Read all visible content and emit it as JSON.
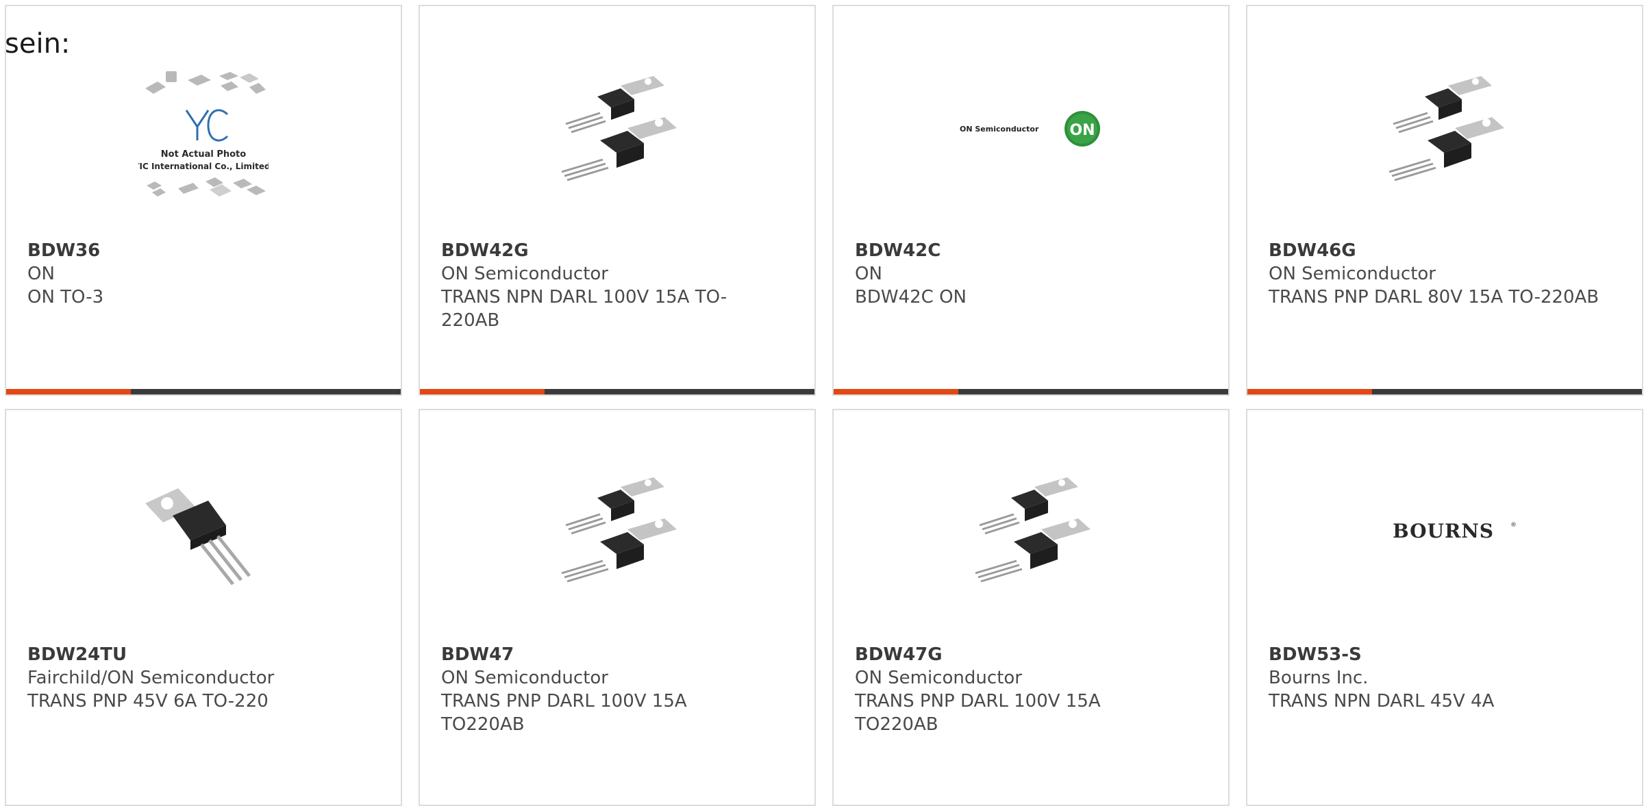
{
  "lead_text": "sein:",
  "colors": {
    "accent": "#e24715",
    "bar": "#3b3b3b",
    "border": "#dcdcdc",
    "text": "#4a4a4a"
  },
  "products": [
    {
      "part": "BDW36",
      "manufacturer": "ON",
      "description": "ON TO-3",
      "image": "yic-placeholder-image",
      "placeholder_line1": "Not Actual Photo",
      "placeholder_line2": "YIC International Co., Limited."
    },
    {
      "part": "BDW42G",
      "manufacturer": "ON Semiconductor",
      "description": "TRANS NPN DARL 100V 15A TO-220AB",
      "image": "to220-pair-image"
    },
    {
      "part": "BDW42C",
      "manufacturer": "ON",
      "description": "BDW42C ON",
      "image": "on-semiconductor-logo",
      "logo_text": "ON Semiconductor"
    },
    {
      "part": "BDW46G",
      "manufacturer": "ON Semiconductor",
      "description": "TRANS PNP DARL 80V 15A TO-220AB",
      "image": "to220-pair-image"
    },
    {
      "part": "BDW24TU",
      "manufacturer": "Fairchild/ON Semiconductor",
      "description": "TRANS PNP 45V 6A TO-220",
      "image": "to220-single-image"
    },
    {
      "part": "BDW47",
      "manufacturer": "ON Semiconductor",
      "description": "TRANS PNP DARL 100V 15A TO220AB",
      "image": "to220-pair-image"
    },
    {
      "part": "BDW47G",
      "manufacturer": "ON Semiconductor",
      "description": "TRANS PNP DARL 100V 15A TO220AB",
      "image": "to220-pair-image"
    },
    {
      "part": "BDW53-S",
      "manufacturer": "Bourns Inc.",
      "description": "TRANS NPN DARL 45V 4A",
      "image": "bourns-logo",
      "logo_text": "BOURNS"
    }
  ]
}
